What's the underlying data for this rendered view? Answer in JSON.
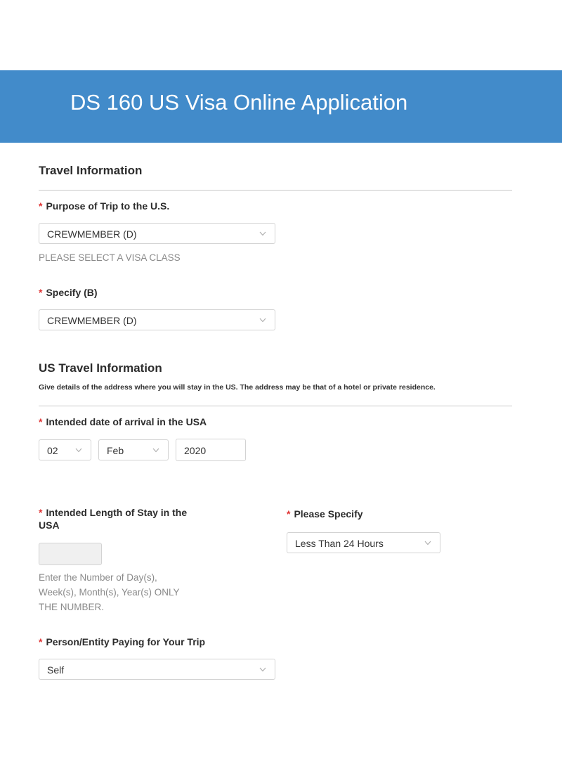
{
  "header": {
    "title": "DS 160 US Visa Online Application"
  },
  "travel_info": {
    "title": "Travel Information",
    "purpose": {
      "label": "Purpose of Trip to the U.S.",
      "value": "CREWMEMBER (D)",
      "help": "PLEASE SELECT A VISA CLASS"
    },
    "specify": {
      "label": "Specify (B)",
      "value": "CREWMEMBER (D)"
    }
  },
  "us_travel": {
    "title": "US Travel Information",
    "subtitle": "Give details of the address where you will stay in the US. The address may be that of a hotel or private residence.",
    "arrival": {
      "label": "Intended date of arrival in the USA",
      "day": "02",
      "month": "Feb",
      "year": "2020"
    },
    "length": {
      "label_line1": "Intended Length of Stay in the",
      "label_line2": "USA",
      "value": "",
      "help_line1": "Enter the Number of Day(s),",
      "help_line2": "Week(s), Month(s), Year(s) ONLY",
      "help_line3": "THE NUMBER."
    },
    "please_specify": {
      "label": "Please Specify",
      "value": "Less Than 24 Hours"
    },
    "paying": {
      "label": "Person/Entity Paying for Your Trip",
      "value": "Self"
    }
  },
  "required_marker": "*",
  "colors": {
    "header_bg": "#428bca",
    "required": "#e03434"
  }
}
